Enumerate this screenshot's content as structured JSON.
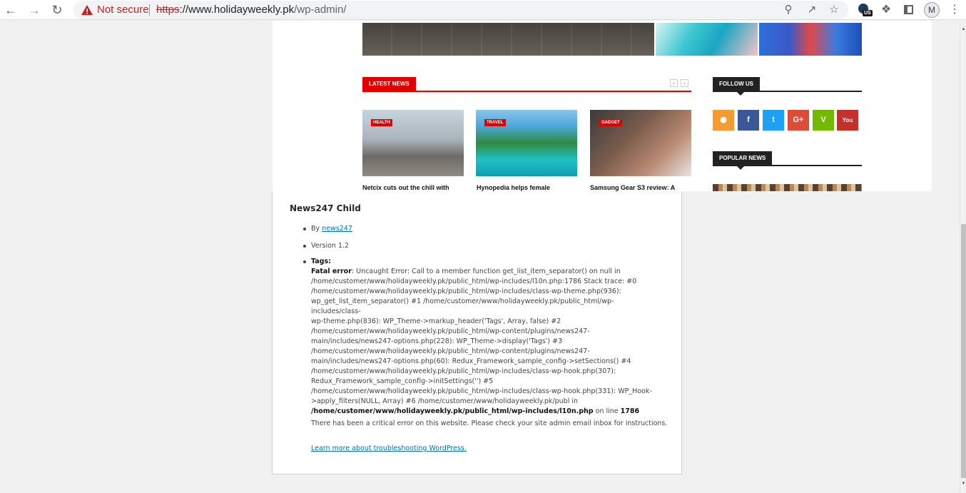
{
  "browser": {
    "security_label": "Not secure",
    "url_scheme": "https",
    "url_host": "://www.holidayweekly.pk",
    "url_path": "/wp-admin/",
    "profile_initial": "M",
    "vpn_badge": "US"
  },
  "site": {
    "latest_news_label": "LATEST NEWS",
    "follow_us_label": "FOLLOW US",
    "popular_news_label": "POPULAR NEWS",
    "news": [
      {
        "tag": "HEALTH",
        "title": "Netcix cuts out the chill with"
      },
      {
        "tag": "TRAVEL",
        "title": "Hynopedia helps female"
      },
      {
        "tag": "GADGET",
        "title": "Samsung Gear S3 review: A"
      }
    ],
    "social": [
      {
        "icon": "rss-icon",
        "glyph": "◉",
        "color": "#f39c34"
      },
      {
        "icon": "facebook-icon",
        "glyph": "f",
        "color": "#3b5998"
      },
      {
        "icon": "twitter-icon",
        "glyph": "t",
        "color": "#1da1f2"
      },
      {
        "icon": "googleplus-icon",
        "glyph": "G+",
        "color": "#dd4b39"
      },
      {
        "icon": "vine-icon",
        "glyph": "V",
        "color": "#72b900"
      },
      {
        "icon": "youtube-icon",
        "glyph": "You",
        "color": "#c4302b"
      }
    ]
  },
  "error": {
    "theme_name": "News247 Child",
    "by_prefix": "By ",
    "author": "news247",
    "version": "Version 1.2",
    "tags_label": "Tags:",
    "fatal_label": "Fatal error",
    "fatal_message": ": Uncaught Error: Call to a member function get_list_item_separator() on null in\n/home/customer/www/holidayweekly.pk/public_html/wp-includes/l10n.php:1786 Stack trace: #0\n/home/customer/www/holidayweekly.pk/public_html/wp-includes/class-wp-theme.php(936):\nwp_get_list_item_separator() #1 /home/customer/www/holidayweekly.pk/public_html/wp-includes/class-\nwp-theme.php(836): WP_Theme->markup_header('Tags', Array, false) #2\n/home/customer/www/holidayweekly.pk/public_html/wp-content/plugins/news247-\nmain/includes/news247-options.php(228): WP_Theme->display('Tags') #3\n/home/customer/www/holidayweekly.pk/public_html/wp-content/plugins/news247-\nmain/includes/news247-options.php(60): Redux_Framework_sample_config->setSections() #4\n/home/customer/www/holidayweekly.pk/public_html/wp-includes/class-wp-hook.php(307):\nRedux_Framework_sample_config->initSettings('') #5\n/home/customer/www/holidayweekly.pk/public_html/wp-includes/class-wp-hook.php(331): WP_Hook-\n>apply_filters(NULL, Array) #6 /home/customer/www/holidayweekly.pk/publ in\n",
    "fatal_file": "/home/customer/www/holidayweekly.pk/public_html/wp-includes/l10n.php",
    "on_line": " on line ",
    "line_number": "1786",
    "critical_message": "There has been a critical error on this website. Please check your site admin email inbox for instructions.",
    "learn_more": "Learn more about troubleshooting WordPress."
  }
}
